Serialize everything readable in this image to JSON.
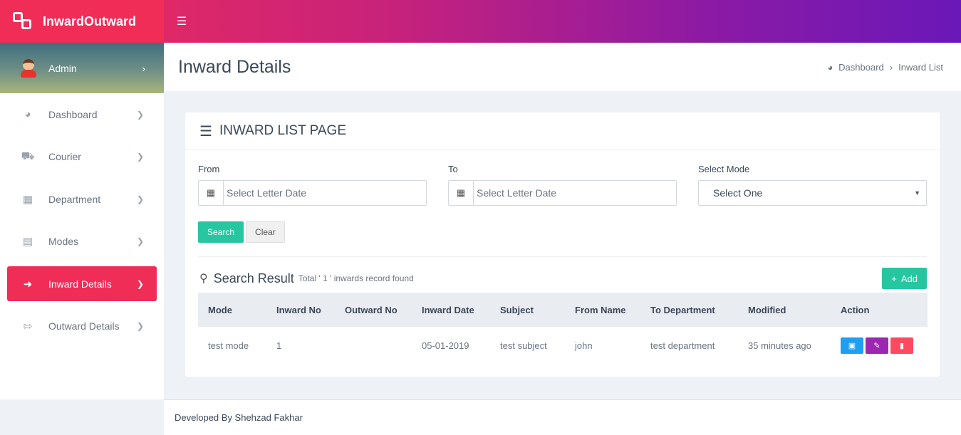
{
  "app": {
    "name": "InwardOutward",
    "brand_color": "#ef2d56",
    "accent_color": "#26c6a0"
  },
  "user": {
    "name": "Admin"
  },
  "sidebar": {
    "items": [
      {
        "label": "Dashboard",
        "icon": "dashboard-icon"
      },
      {
        "label": "Courier",
        "icon": "truck-icon"
      },
      {
        "label": "Department",
        "icon": "building-icon"
      },
      {
        "label": "Modes",
        "icon": "server-icon"
      },
      {
        "label": "Inward Details",
        "icon": "sign-in-icon",
        "active": true
      },
      {
        "label": "Outward Details",
        "icon": "sign-out-icon"
      }
    ]
  },
  "header": {
    "title": "Inward Details",
    "breadcrumb": [
      "Dashboard",
      "Inward List"
    ]
  },
  "card": {
    "title": "INWARD LIST PAGE",
    "filters": {
      "from_label": "From",
      "from_placeholder": "Select Letter Date",
      "to_label": "To",
      "to_placeholder": "Select Letter Date",
      "mode_label": "Select Mode",
      "mode_value": "Select One"
    },
    "search_label": "Search",
    "clear_label": "Clear",
    "result_title": "Search Result",
    "result_sub": "Total ' 1 ' inwards record found",
    "add_label": "Add"
  },
  "table": {
    "columns": [
      "Mode",
      "Inward No",
      "Outward No",
      "Inward Date",
      "Subject",
      "From Name",
      "To Department",
      "Modified",
      "Action"
    ],
    "rows": [
      {
        "mode": "test mode",
        "inward_no": "1",
        "outward_no": "",
        "inward_date": "05-01-2019",
        "subject": "test subject",
        "from_name": "john",
        "to_department": "test department",
        "modified": "35 minutes ago"
      }
    ],
    "action_colors": {
      "view": "#1e9ff2",
      "edit": "#9c27b0",
      "delete": "#ff4961"
    }
  },
  "footer": {
    "text": "Developed By Shehzad Fakhar"
  }
}
